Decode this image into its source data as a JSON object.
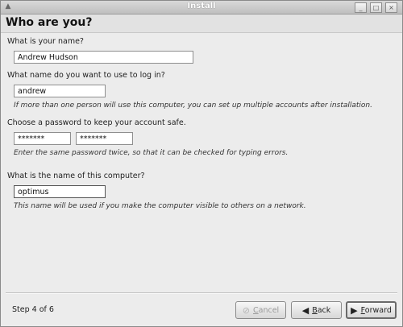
{
  "window": {
    "title": "Install",
    "menu_icon": "window-menu-icon",
    "controls": {
      "minimize": "_",
      "maximize": "□",
      "close": "×"
    }
  },
  "page": {
    "heading": "Who are you?"
  },
  "form": {
    "name_label": "What is your name?",
    "name_value": "Andrew Hudson",
    "login_label": "What name do you want to use to log in?",
    "login_value": "andrew",
    "login_hint": "If more than one person will use this computer, you can set up multiple accounts after installation.",
    "password_label": "Choose a password to keep your account safe.",
    "password_value": "*******",
    "password_confirm_value": "*******",
    "password_hint": "Enter the same password twice, so that it can be checked for typing errors.",
    "computer_label": "What is the name of this computer?",
    "computer_value": "optimus",
    "computer_hint": "This name will be used if you make the computer visible to others on a network."
  },
  "footer": {
    "step": "Step 4 of 6",
    "cancel_mnemonic": "C",
    "cancel_rest": "ancel",
    "back_mnemonic": "B",
    "back_rest": "ack",
    "forward_mnemonic": "F",
    "forward_rest": "orward"
  },
  "icons": {
    "cancel": "cancel-icon",
    "back": "back-arrow-icon",
    "forward": "forward-arrow-icon"
  }
}
